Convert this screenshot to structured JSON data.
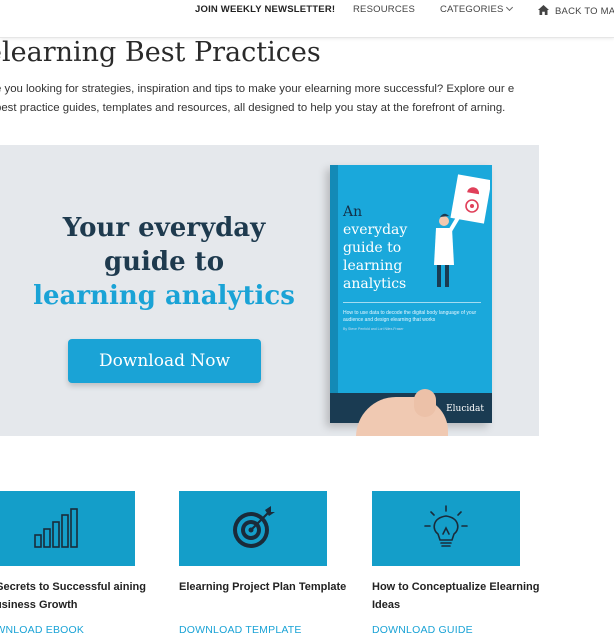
{
  "nav": {
    "newsletter": "JOIN WEEKLY NEWSLETTER!",
    "resources": "RESOURCES",
    "categories": "CATEGORIES",
    "back": "BACK TO MAI"
  },
  "page": {
    "title": "elearning Best Practices",
    "intro": "e you looking for strategies, inspiration and tips to make your elearning more successful? Explore our e best practice guides, templates and resources, all designed to help you stay at the forefront of arning."
  },
  "banner": {
    "heading_line1": "Your everyday",
    "heading_line2": "guide to",
    "heading_line3": "learning analytics",
    "button": "Download Now",
    "book": {
      "title_line1": "An",
      "title_line2": "everyday",
      "title_line3": "guide to",
      "title_line4": "learning",
      "title_line5": "analytics",
      "subtitle": "How to use data to decode the digital body language of your audience and design elearning that works",
      "authors": "By Steve Penfold and Lori Nilex-Fraser",
      "brand": "Elucidat"
    }
  },
  "cards": [
    {
      "icon": "bar-chart-icon",
      "title": "e Secrets to Successful aining Business Growth",
      "link": "OWNLOAD EBOOK"
    },
    {
      "icon": "target-icon",
      "title": "Elearning Project Plan Template",
      "link": "DOWNLOAD TEMPLATE"
    },
    {
      "icon": "lightbulb-icon",
      "title": "How to Conceptualize Elearning Ideas",
      "link": "DOWNLOAD GUIDE"
    }
  ],
  "colors": {
    "accent": "#1aa3d6",
    "tile": "#149ec9",
    "dark_navy": "#1e3a4e",
    "banner_bg": "#e5e8ec"
  }
}
